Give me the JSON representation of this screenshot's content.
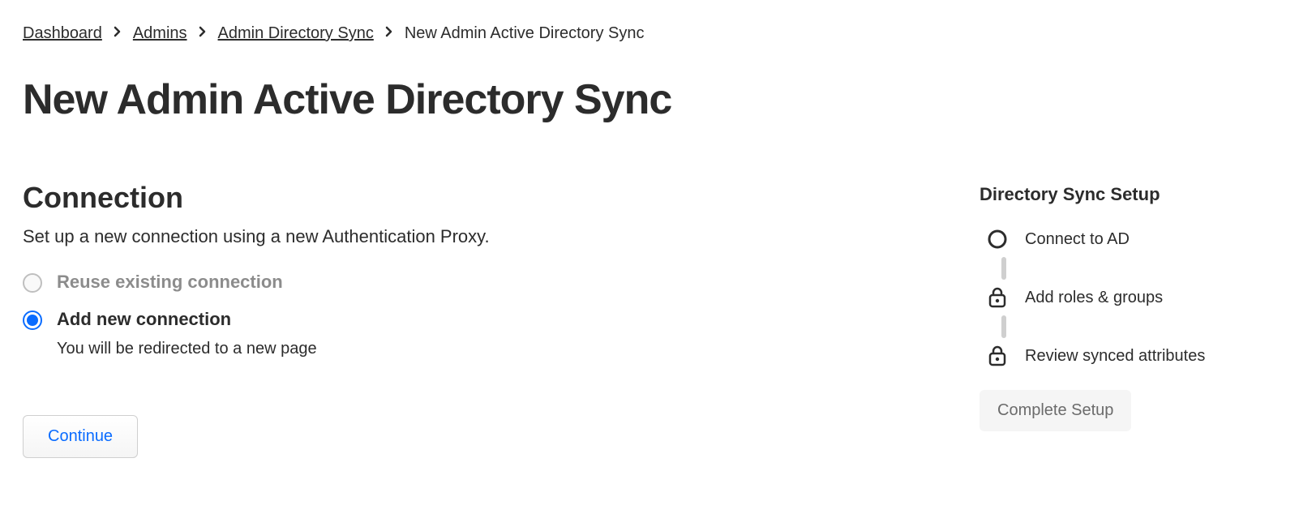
{
  "breadcrumb": {
    "items": [
      "Dashboard",
      "Admins",
      "Admin Directory Sync"
    ],
    "current": "New Admin Active Directory Sync"
  },
  "page_title": "New Admin Active Directory Sync",
  "section": {
    "title": "Connection",
    "description": "Set up a new connection using a new Authentication Proxy."
  },
  "options": {
    "reuse": {
      "label": "Reuse existing connection"
    },
    "add_new": {
      "label": "Add new connection",
      "sub": "You will be redirected to a new page"
    }
  },
  "continue_label": "Continue",
  "sidebar": {
    "title": "Directory Sync Setup",
    "steps": [
      {
        "label": "Connect to AD",
        "icon": "circle"
      },
      {
        "label": "Add roles & groups",
        "icon": "lock"
      },
      {
        "label": "Review synced attributes",
        "icon": "lock"
      }
    ],
    "complete_label": "Complete Setup"
  }
}
